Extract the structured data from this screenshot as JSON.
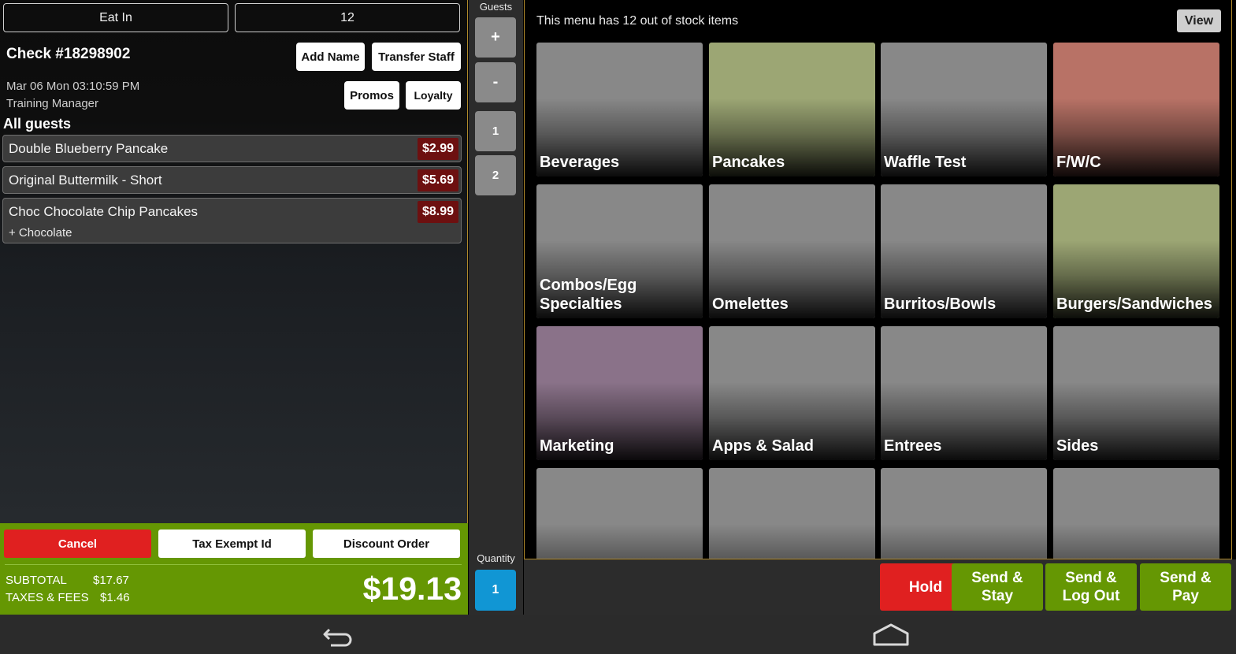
{
  "header": {
    "order_type": "Eat In",
    "table_number": "12"
  },
  "check": {
    "title": "Check #18298902",
    "datetime": "Mar 06 Mon 03:10:59 PM",
    "staff": "Training Manager",
    "buttons": {
      "add_name": "Add Name",
      "transfer_staff": "Transfer Staff",
      "promos": "Promos",
      "loyalty": "Loyalty"
    }
  },
  "order": {
    "heading": "All guests",
    "items": [
      {
        "name": "Double Blueberry Pancake",
        "price": "$2.99",
        "modifier": ""
      },
      {
        "name": "Original Buttermilk - Short",
        "price": "$5.69",
        "modifier": ""
      },
      {
        "name": "Choc Chocolate Chip Pancakes",
        "price": "$8.99",
        "modifier": "+ Chocolate"
      }
    ]
  },
  "footer": {
    "cancel": "Cancel",
    "tax_exempt": "Tax Exempt Id",
    "discount": "Discount Order",
    "subtotal_label": "SUBTOTAL",
    "subtotal_value": "$17.67",
    "taxes_label": "TAXES & FEES",
    "taxes_value": "$1.46",
    "total": "$19.13"
  },
  "guests": {
    "label": "Guests",
    "plus": "+",
    "minus": "-",
    "seats": [
      "1",
      "2"
    ]
  },
  "quantity": {
    "label": "Quantity",
    "value": "1"
  },
  "menu": {
    "stock_message": "This menu has 12 out of stock items",
    "view": "View",
    "categories": [
      {
        "label": "Beverages",
        "color": "#888888"
      },
      {
        "label": "Pancakes",
        "color": "#9ca674"
      },
      {
        "label": "Waffle Test",
        "color": "#888888"
      },
      {
        "label": "F/W/C",
        "color": "#b87266"
      },
      {
        "label": "Combos/Egg Specialties",
        "color": "#888888"
      },
      {
        "label": "Omelettes",
        "color": "#888888"
      },
      {
        "label": "Burritos/Bowls",
        "color": "#888888"
      },
      {
        "label": "Burgers/Sandwiches",
        "color": "#9ca674"
      },
      {
        "label": "Marketing",
        "color": "#8a7289"
      },
      {
        "label": "Apps & Salad",
        "color": "#888888"
      },
      {
        "label": "Entrees",
        "color": "#888888"
      },
      {
        "label": "Sides",
        "color": "#888888"
      },
      {
        "label": "",
        "color": "#888888"
      },
      {
        "label": "",
        "color": "#888888"
      },
      {
        "label": "",
        "color": "#888888"
      },
      {
        "label": "",
        "color": "#888888"
      }
    ]
  },
  "actions": {
    "hold": "Hold",
    "send_stay": "Send &\nStay",
    "send_logout": "Send &\nLog Out",
    "send_pay": "Send &\nPay",
    "hold_color": "#e02020",
    "send_color": "#659703"
  },
  "nav": {
    "icons": [
      "back-icon",
      "home-icon"
    ]
  }
}
